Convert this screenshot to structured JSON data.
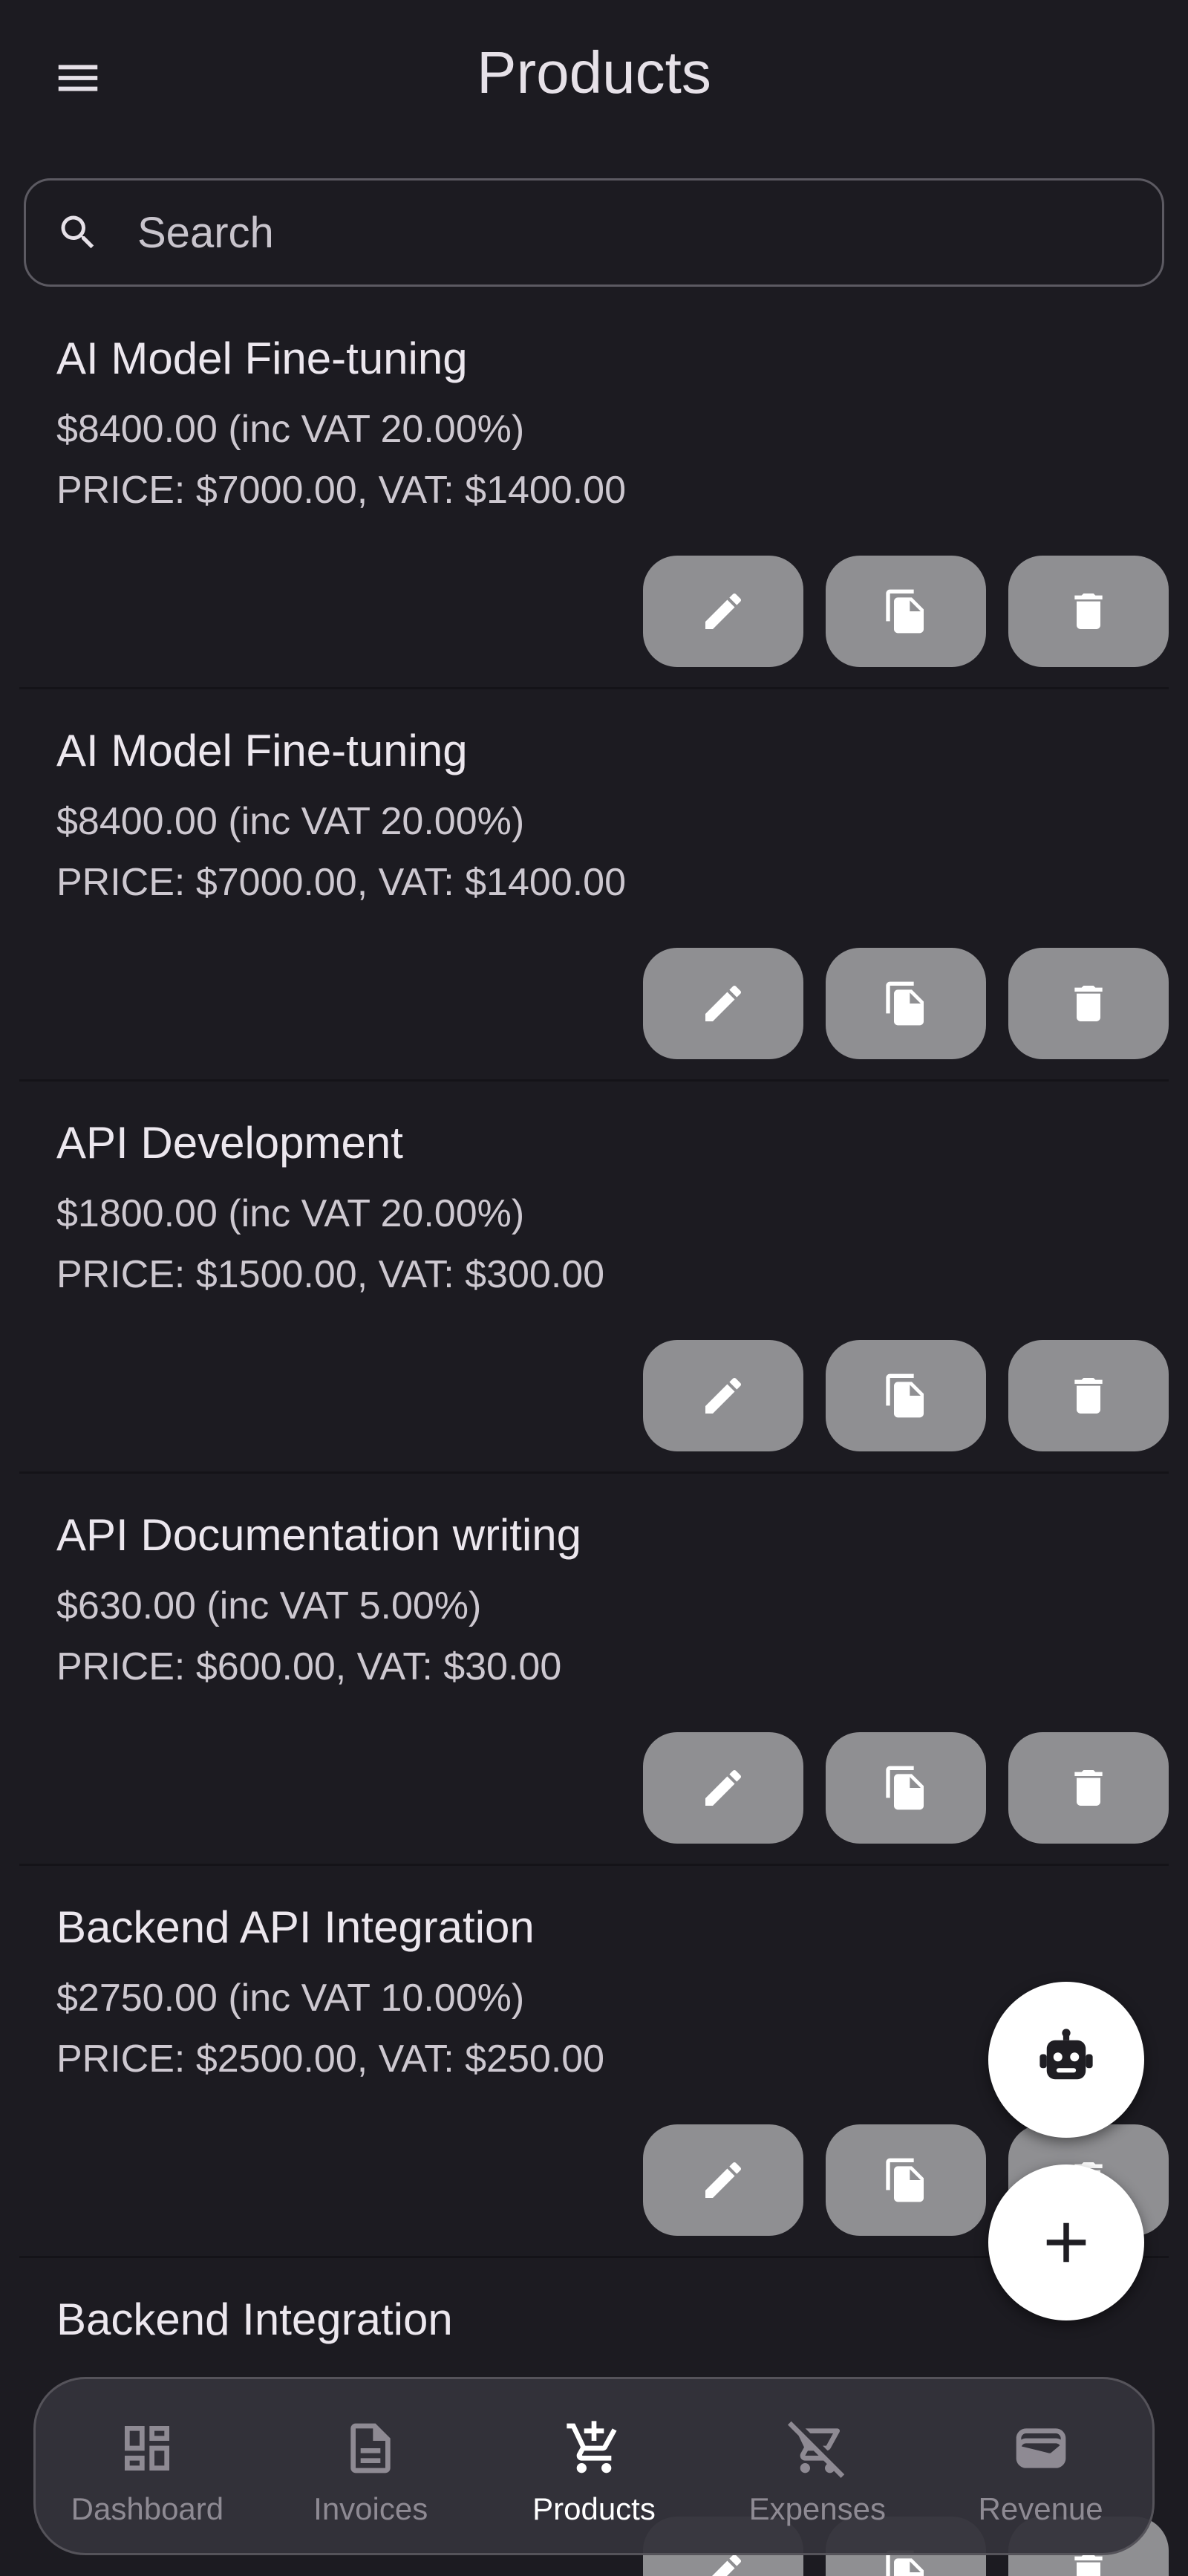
{
  "header": {
    "title": "Products"
  },
  "search": {
    "placeholder": "Search"
  },
  "products": [
    {
      "name": "AI Model Fine-tuning",
      "gross": "$8400.00 (inc VAT 20.00%)",
      "breakdown": "PRICE: $7000.00, VAT: $1400.00"
    },
    {
      "name": "AI Model Fine-tuning",
      "gross": "$8400.00 (inc VAT 20.00%)",
      "breakdown": "PRICE: $7000.00, VAT: $1400.00"
    },
    {
      "name": "API Development",
      "gross": "$1800.00 (inc VAT 20.00%)",
      "breakdown": "PRICE: $1500.00, VAT: $300.00"
    },
    {
      "name": "API Documentation writing",
      "gross": "$630.00 (inc VAT 5.00%)",
      "breakdown": "PRICE: $600.00, VAT: $30.00"
    },
    {
      "name": "Backend API Integration",
      "gross": "$2750.00 (inc VAT 10.00%)",
      "breakdown": "PRICE: $2500.00, VAT: $250.00"
    },
    {
      "name": "Backend Integration",
      "gross": "",
      "breakdown": ""
    }
  ],
  "nav": [
    {
      "label": "Dashboard",
      "icon": "dashboard-icon"
    },
    {
      "label": "Invoices",
      "icon": "invoice-icon"
    },
    {
      "label": "Products",
      "icon": "cart-add-icon"
    },
    {
      "label": "Expenses",
      "icon": "cart-off-icon"
    },
    {
      "label": "Revenue",
      "icon": "wallet-icon"
    }
  ],
  "nav_active": "Products",
  "colors": {
    "background": "#1c1b21",
    "action_button": "#8f8f92",
    "fab": "#ffffff",
    "nav_active": "#ffffff",
    "nav_inactive": "#8e8a93"
  }
}
